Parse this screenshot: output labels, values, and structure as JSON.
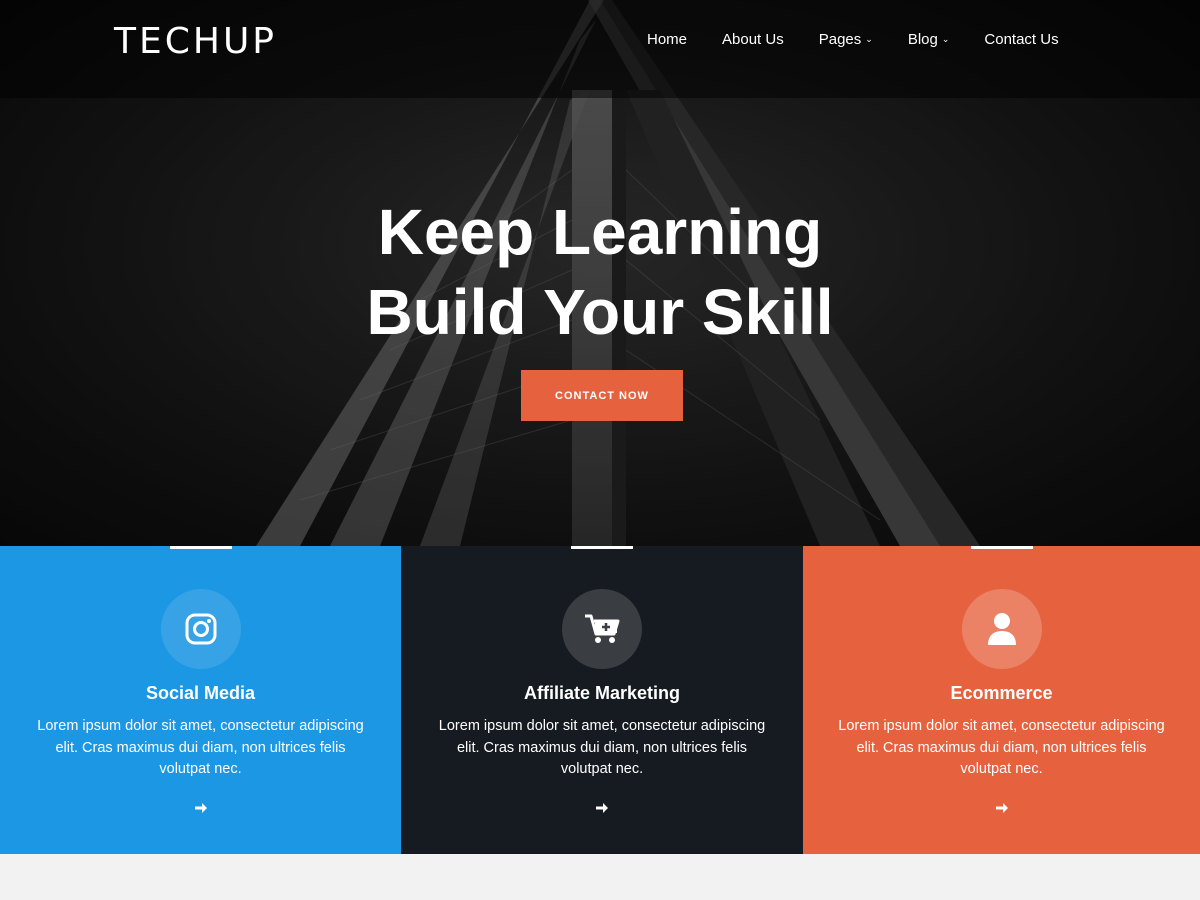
{
  "brand": {
    "logo": "TECHUP"
  },
  "nav": {
    "items": [
      {
        "label": "Home",
        "dropdown": false
      },
      {
        "label": "About Us",
        "dropdown": false
      },
      {
        "label": "Pages",
        "dropdown": true
      },
      {
        "label": "Blog",
        "dropdown": true
      },
      {
        "label": "Contact Us",
        "dropdown": false
      }
    ]
  },
  "hero": {
    "line1": "Keep Learning",
    "line2": "Build Your Skill",
    "cta_label": "CONTACT NOW"
  },
  "services": [
    {
      "title": "Social Media",
      "icon": "instagram-icon",
      "color": "#1c97e3",
      "desc": "Lorem ipsum dolor sit amet, consectetur adipiscing elit. Cras maximus dui diam, non ultrices felis volutpat nec."
    },
    {
      "title": "Affiliate Marketing",
      "icon": "cart-plus-icon",
      "color": "#161b21",
      "desc": "Lorem ipsum dolor sit amet, consectetur adipiscing elit. Cras maximus dui diam, non ultrices felis volutpat nec."
    },
    {
      "title": "Ecommerce",
      "icon": "user-icon",
      "color": "#e6623f",
      "desc": "Lorem ipsum dolor sit amet, consectetur adipiscing elit. Cras maximus dui diam, non ultrices felis volutpat nec."
    }
  ],
  "colors": {
    "accent": "#e6623f",
    "blue": "#1c97e3",
    "dark": "#161b21"
  }
}
